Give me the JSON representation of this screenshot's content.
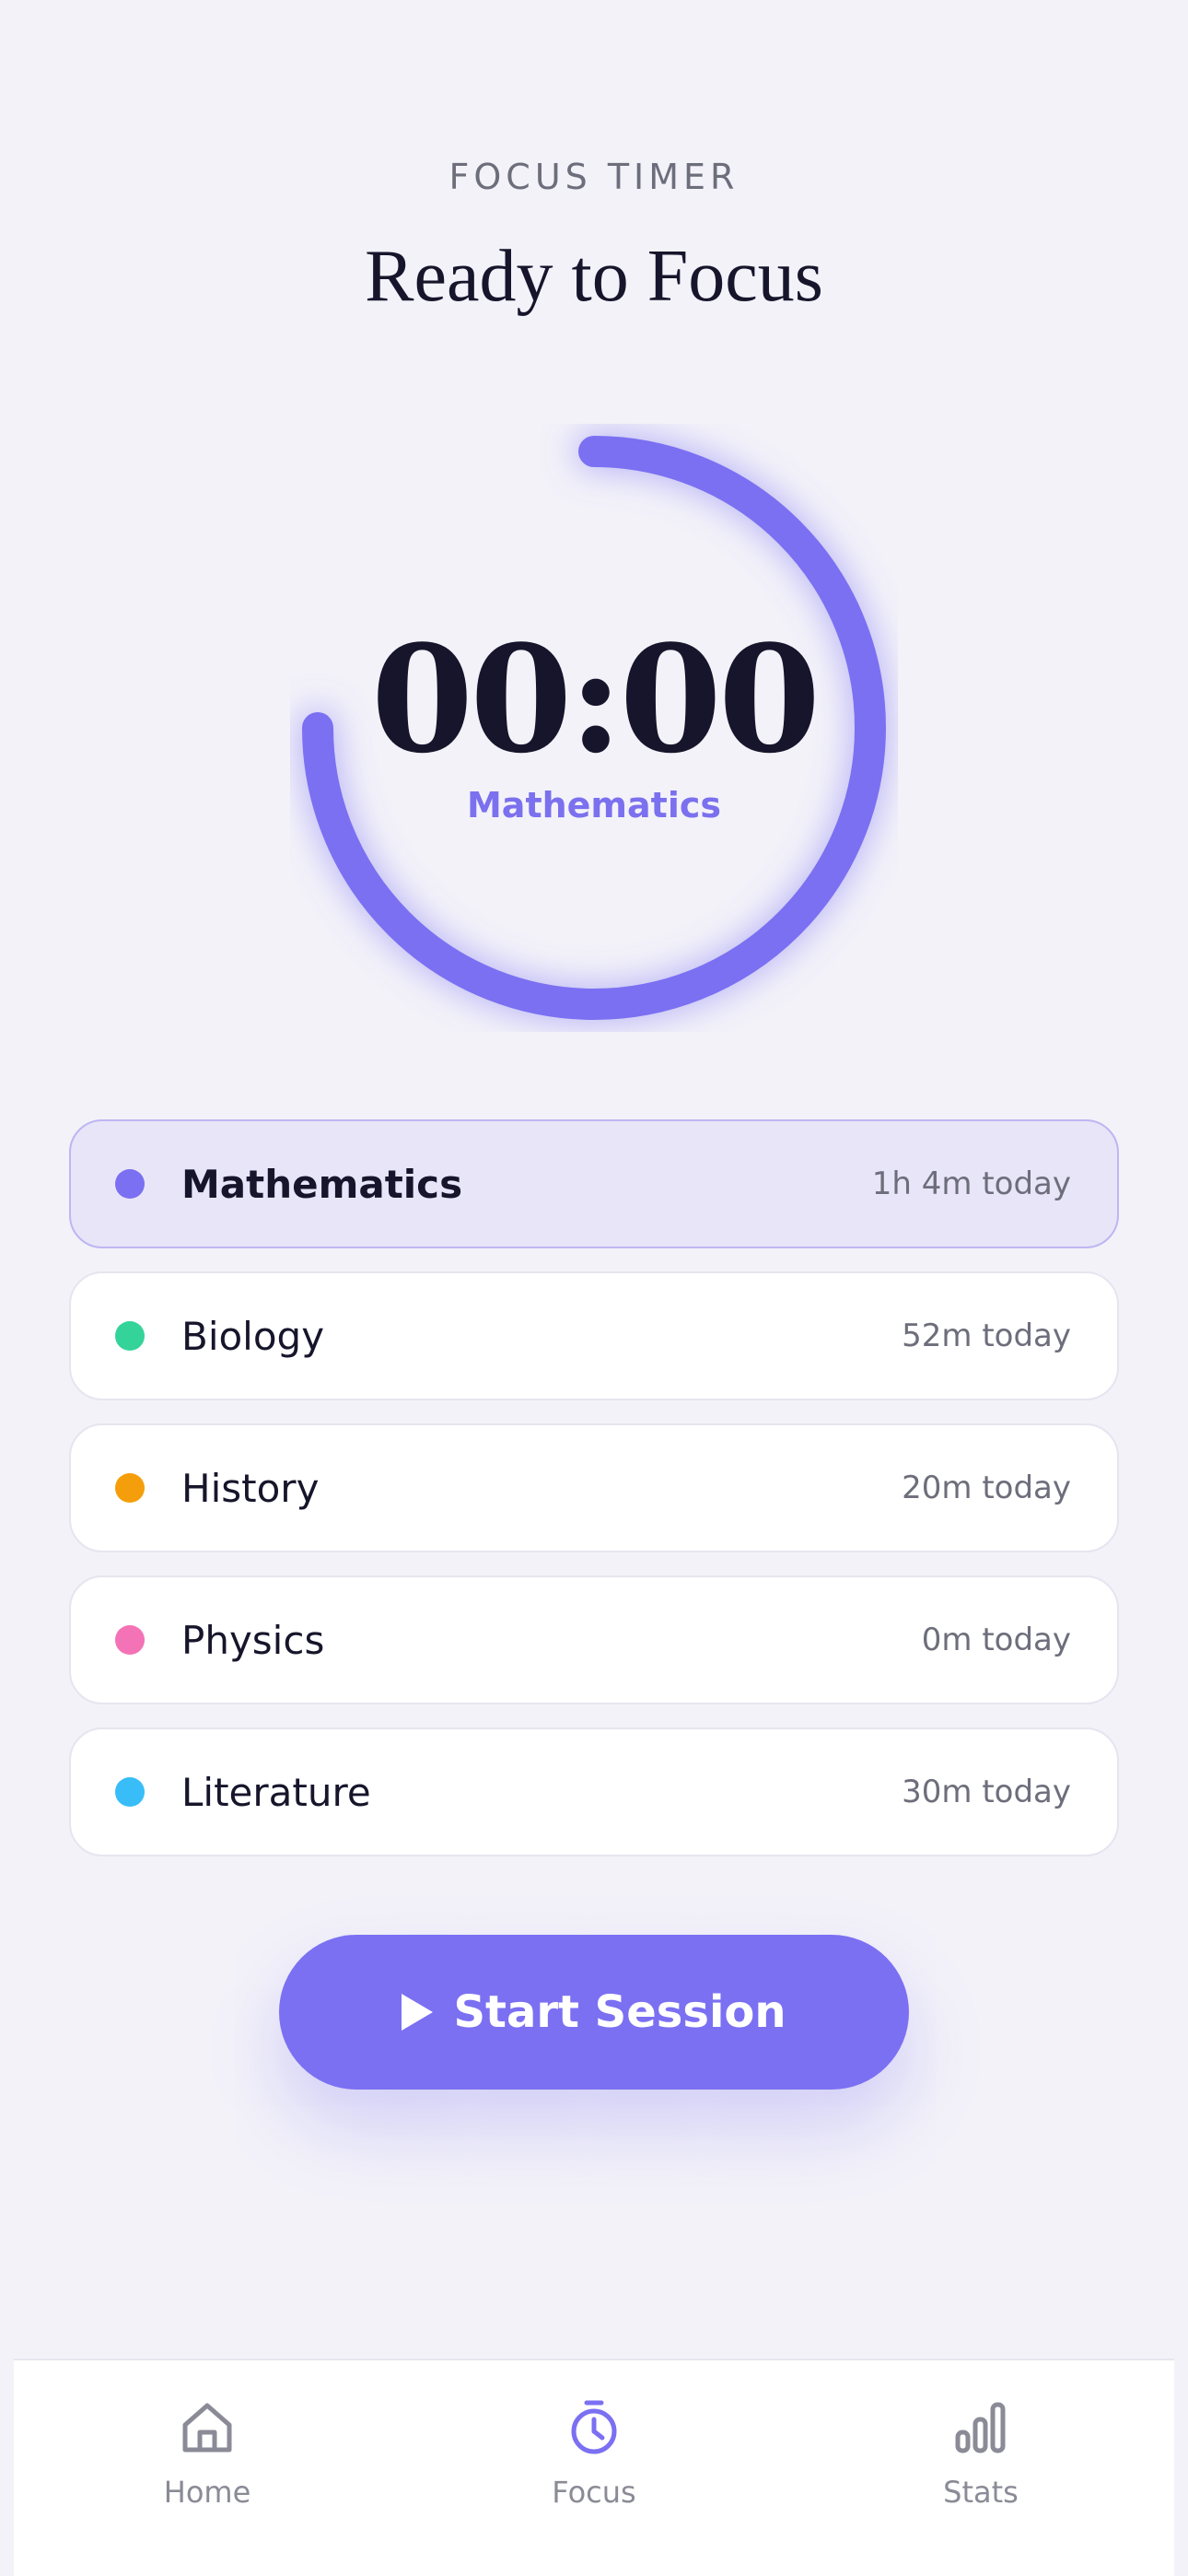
{
  "header": {
    "eyebrow": "FOCUS TIMER",
    "title": "Ready to Focus"
  },
  "timer": {
    "time": "00:00",
    "subject": "Mathematics",
    "ring_progress": 0.75,
    "accent_color": "#7B70F2"
  },
  "subjects": [
    {
      "name": "Mathematics",
      "time": "1h 4m today",
      "color": "#7B70F2",
      "active": true
    },
    {
      "name": "Biology",
      "time": "52m today",
      "color": "#34D399",
      "active": false
    },
    {
      "name": "History",
      "time": "20m today",
      "color": "#F59E0B",
      "active": false
    },
    {
      "name": "Physics",
      "time": "0m today",
      "color": "#F472B6",
      "active": false
    },
    {
      "name": "Literature",
      "time": "30m today",
      "color": "#38BDF8",
      "active": false
    }
  ],
  "start_button": {
    "label": "Start Session",
    "icon": "play-icon"
  },
  "tabbar": {
    "items": [
      {
        "label": "Home",
        "icon": "home-icon",
        "active": false
      },
      {
        "label": "Focus",
        "icon": "stopwatch-icon",
        "active": true
      },
      {
        "label": "Stats",
        "icon": "bar-chart-icon",
        "active": false
      }
    ]
  }
}
